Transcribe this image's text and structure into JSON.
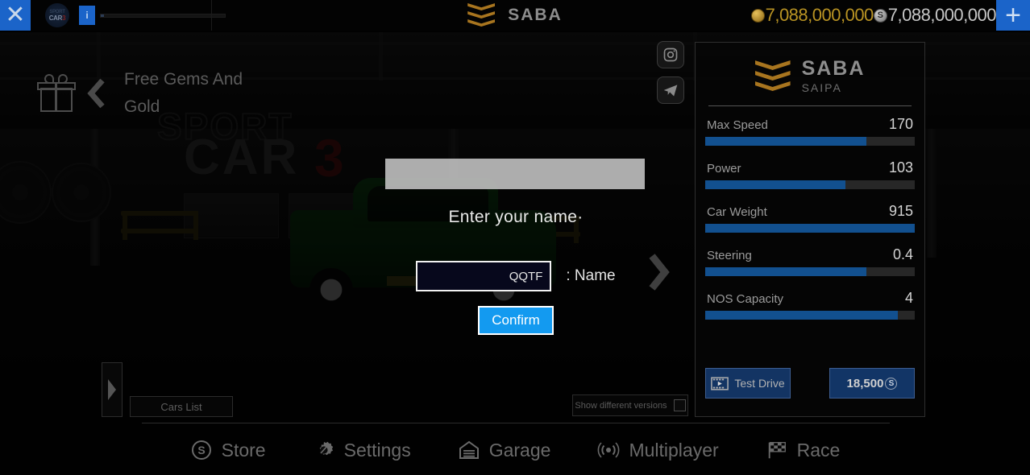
{
  "topbar": {
    "close_icon": "close-x-icon",
    "game_logo_top": "SPORT",
    "game_logo_bottom": "CAR",
    "game_logo_accent": "3",
    "account_icon_label": "i",
    "brand_name": "SABA",
    "gold_amount": "7,088,000,000",
    "silver_amount": "7,088,000,000",
    "silver_symbol": "S",
    "plus_label": "+"
  },
  "promo": {
    "gift_icon": "gift-icon",
    "chevron_icon": "chevron-left-icon",
    "text": "Free Gems And Gold"
  },
  "social": {
    "items": [
      {
        "name": "instagram-icon"
      },
      {
        "name": "telegram-icon"
      }
    ]
  },
  "car_panel": {
    "title": "SABA",
    "subtitle": "SAIPA",
    "stats": [
      {
        "label": "Max Speed",
        "value": "170",
        "percent": 77
      },
      {
        "label": "Power",
        "value": "103",
        "percent": 67
      },
      {
        "label": "Car Weight",
        "value": "915",
        "percent": 100
      },
      {
        "label": "Steering",
        "value": "0.4",
        "percent": 77
      },
      {
        "label": "NOS Capacity",
        "value": "4",
        "percent": 92
      }
    ],
    "test_drive_label": "Test Drive",
    "price_label": "18,500",
    "price_symbol": "S"
  },
  "scene": {
    "next_car_icon": "chevron-right-icon",
    "drawer_icon": "drawer-arrow-icon",
    "cars_list_label": "Cars List",
    "versions_label": "Show different versions",
    "versions_checked": false
  },
  "modal": {
    "title": "Enter your name·",
    "input_value": "QQTF",
    "input_placeholder": "Name",
    "field_label": ": Name",
    "confirm_label": "Confirm"
  },
  "bottom_nav": {
    "items": [
      {
        "label": "Store",
        "icon": "store-coin-icon"
      },
      {
        "label": "Settings",
        "icon": "gear-icon"
      },
      {
        "label": "Garage",
        "icon": "garage-icon"
      },
      {
        "label": "Multiplayer",
        "icon": "broadcast-icon"
      },
      {
        "label": "Race",
        "icon": "checkered-flag-icon"
      }
    ]
  },
  "colors": {
    "accent_blue": "#1b64c9",
    "bar_blue": "#12508f",
    "gold": "#b99323",
    "confirm_blue": "#139af0"
  }
}
